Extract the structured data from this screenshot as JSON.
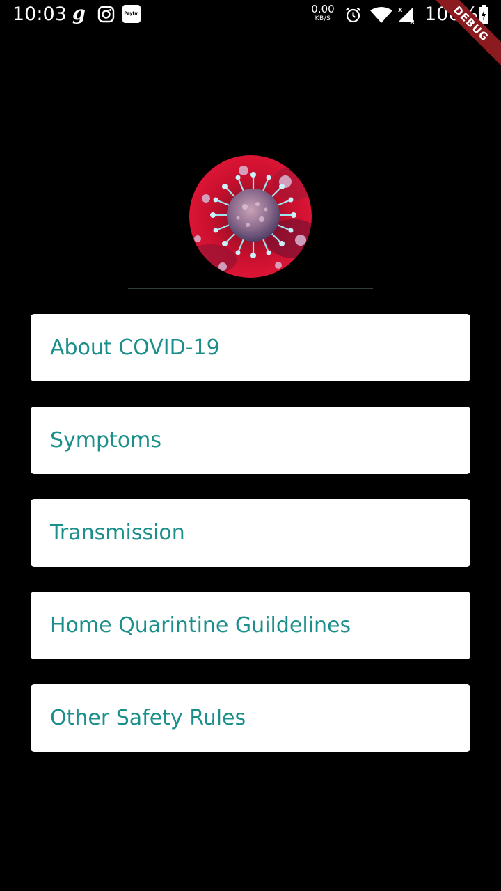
{
  "status_bar": {
    "time": "10:03",
    "net_speed_value": "0.00",
    "net_speed_unit": "KB/S",
    "battery_percent": "100%",
    "paytm_label": "Paytm",
    "icons": [
      "g-app-icon",
      "instagram-icon",
      "paytm-icon",
      "alarm-icon",
      "wifi-icon",
      "cellular-signal-icon",
      "battery-charging-icon"
    ]
  },
  "debug_banner": "DEBUG",
  "hero": {
    "image": "coronavirus-image"
  },
  "menu": {
    "items": [
      {
        "label": "About COVID-19"
      },
      {
        "label": "Symptoms"
      },
      {
        "label": "Transmission"
      },
      {
        "label": "Home Quarintine Guildelines"
      },
      {
        "label": "Other Safety Rules"
      }
    ]
  },
  "colors": {
    "background": "#000000",
    "card": "#ffffff",
    "accent_text": "#1b8f8b",
    "debug_banner": "#8b1b1f"
  }
}
